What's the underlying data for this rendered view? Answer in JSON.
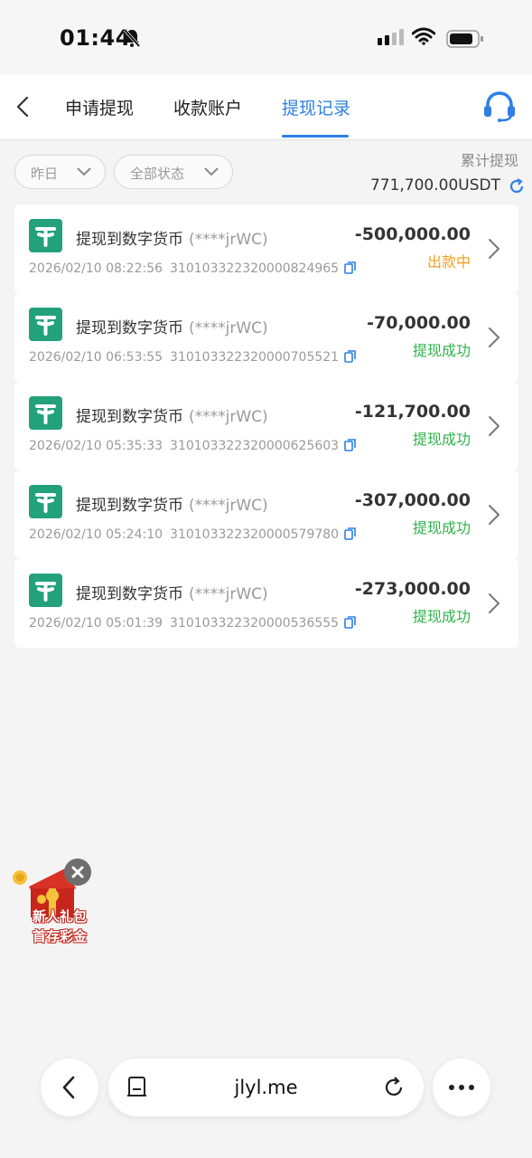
{
  "status_bar": {
    "time": "01:44"
  },
  "nav": {
    "tabs": [
      {
        "label": "申请提现",
        "active": false
      },
      {
        "label": "收款账户",
        "active": false
      },
      {
        "label": "提现记录",
        "active": true
      }
    ],
    "accent_color": "#2d7fe6"
  },
  "filters": {
    "date": "昨日",
    "status": "全部状态"
  },
  "summary": {
    "label": "累计提现",
    "value": "771,700.00USDT"
  },
  "records": [
    {
      "title": "提现到数字货币",
      "masked": "(****jrWC)",
      "time": "2026/02/10 08:22:56",
      "order_id": "310103322320000824965",
      "amount": "-500,000.00",
      "status": "出款中",
      "status_type": "pending"
    },
    {
      "title": "提现到数字货币",
      "masked": "(****jrWC)",
      "time": "2026/02/10 06:53:55",
      "order_id": "310103322320000705521",
      "amount": "-70,000.00",
      "status": "提现成功",
      "status_type": "success"
    },
    {
      "title": "提现到数字货币",
      "masked": "(****jrWC)",
      "time": "2026/02/10 05:35:33",
      "order_id": "310103322320000625603",
      "amount": "-121,700.00",
      "status": "提现成功",
      "status_type": "success"
    },
    {
      "title": "提现到数字货币",
      "masked": "(****jrWC)",
      "time": "2026/02/10 05:24:10",
      "order_id": "310103322320000579780",
      "amount": "-307,000.00",
      "status": "提现成功",
      "status_type": "success"
    },
    {
      "title": "提现到数字货币",
      "masked": "(****jrWC)",
      "time": "2026/02/10 05:01:39",
      "order_id": "310103322320000536555",
      "amount": "-273,000.00",
      "status": "提现成功",
      "status_type": "success"
    }
  ],
  "status_colors": {
    "pending": "#f0a020",
    "success": "#2fb34a"
  },
  "promo": {
    "line1": "新人礼包",
    "line2": "首存彩金"
  },
  "browser": {
    "url": "jlyl.me"
  }
}
